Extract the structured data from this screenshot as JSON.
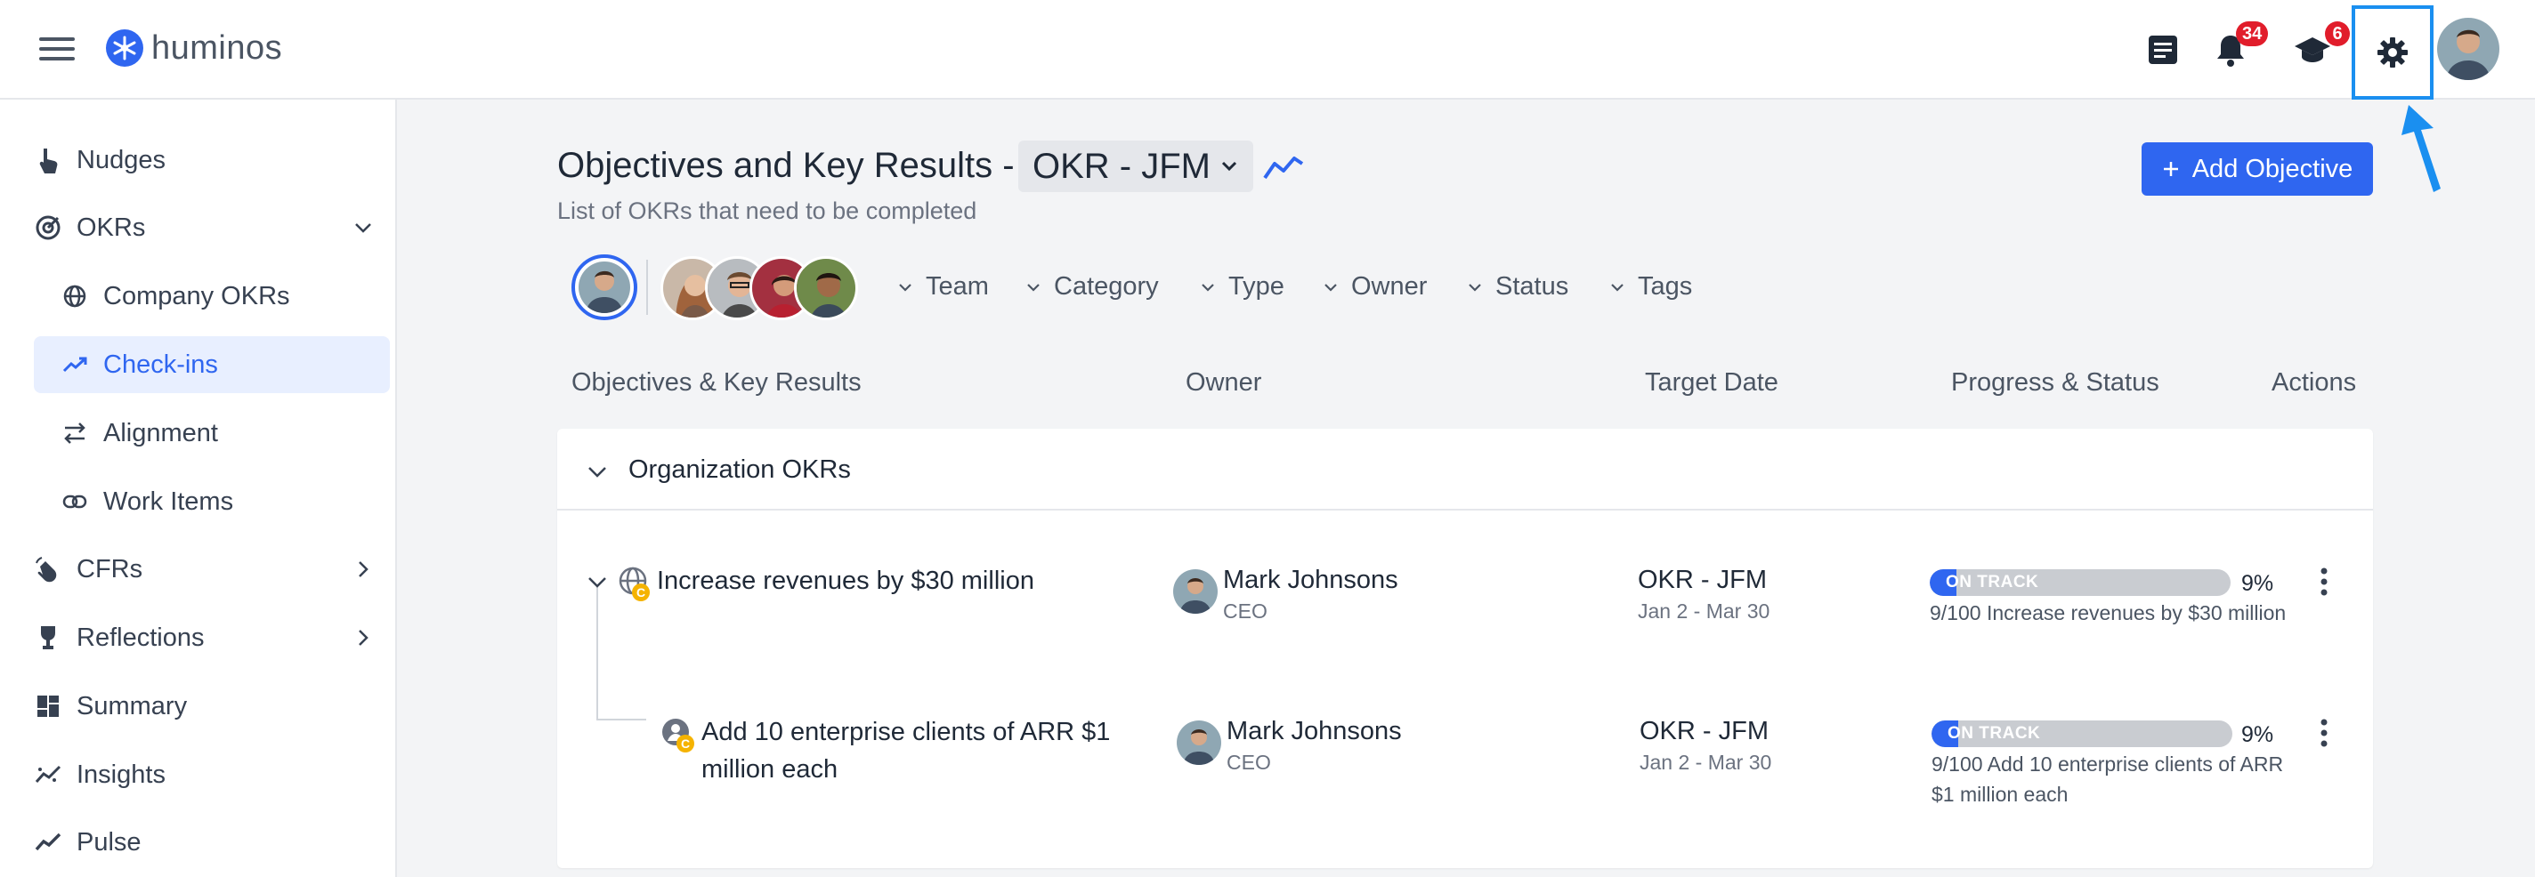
{
  "header": {
    "brand": "huminos",
    "notifications_count": "34",
    "learning_count": "6"
  },
  "sidebar": {
    "items": [
      {
        "label": "Nudges",
        "icon": "hand-pointer-icon"
      },
      {
        "label": "OKRs",
        "icon": "target-icon"
      },
      {
        "label": "Company OKRs",
        "icon": "globe-icon"
      },
      {
        "label": "Check-ins",
        "icon": "trend-icon"
      },
      {
        "label": "Alignment",
        "icon": "arrows-swap-icon"
      },
      {
        "label": "Work Items",
        "icon": "link-icon"
      },
      {
        "label": "CFRs",
        "icon": "hand-wave-icon"
      },
      {
        "label": "Reflections",
        "icon": "trophy-icon"
      },
      {
        "label": "Summary",
        "icon": "dashboard-icon"
      },
      {
        "label": "Insights",
        "icon": "scatter-chart-icon"
      },
      {
        "label": "Pulse",
        "icon": "pulse-icon"
      }
    ]
  },
  "main": {
    "title": "Objectives and Key Results -",
    "period": "OKR - JFM",
    "subtitle": "List of OKRs that need to be completed",
    "add_button": "Add Objective",
    "filters": [
      "Team",
      "Category",
      "Type",
      "Owner",
      "Status",
      "Tags"
    ],
    "columns": [
      "Objectives & Key Results",
      "Owner",
      "Target Date",
      "Progress & Status",
      "Actions"
    ],
    "group_title": "Organization OKRs",
    "rows": [
      {
        "objective": "Increase revenues by $30 million",
        "owner_name": "Mark Johnsons",
        "owner_role": "CEO",
        "target": "OKR - JFM",
        "date_range": "Jan 2 - Mar 30",
        "status": "ON TRACK",
        "progress": 9,
        "pct_label": "9%",
        "progress_desc": "9/100  Increase revenues by $30 million",
        "badge": "C"
      },
      {
        "objective": "Add 10 enterprise clients of ARR $1 million each",
        "owner_name": "Mark Johnsons",
        "owner_role": "CEO",
        "target": "OKR - JFM",
        "date_range": "Jan 2 - Mar 30",
        "status": "ON TRACK",
        "progress": 9,
        "pct_label": "9%",
        "progress_desc": "9/100  Add 10 enterprise clients of ARR $1 million each",
        "badge": "C"
      }
    ]
  },
  "colors": {
    "accent": "#2f66f0",
    "highlight": "#1a8ff0",
    "badge": "#e11d2b",
    "creator_badge": "#f5b301"
  }
}
